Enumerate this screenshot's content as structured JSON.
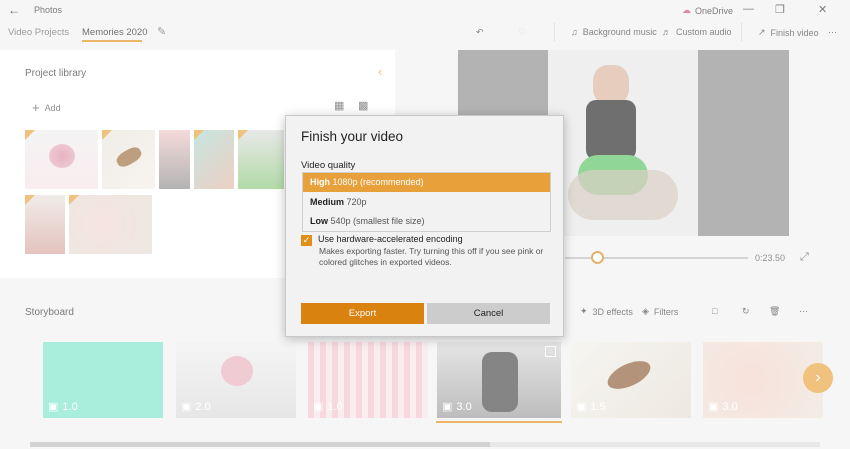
{
  "app": {
    "title": "Photos",
    "onedrive": "OneDrive"
  },
  "tabs": [
    {
      "label": "Video Projects"
    },
    {
      "label": "Memories 2020"
    }
  ],
  "toolbar": {
    "background_music": "Background music",
    "custom_audio": "Custom audio",
    "finish_video": "Finish video"
  },
  "library": {
    "title": "Project library",
    "add_label": "Add"
  },
  "player": {
    "time": "0:23.50"
  },
  "storyboard": {
    "title": "Storyboard",
    "tools": {
      "effects": "3D effects",
      "filters": "Filters"
    },
    "clips": [
      {
        "duration": "1.0"
      },
      {
        "duration": "2.0"
      },
      {
        "duration": "1.0"
      },
      {
        "duration": "3.0"
      },
      {
        "duration": "1.5"
      },
      {
        "duration": "3.0"
      }
    ]
  },
  "dialog": {
    "title": "Finish your video",
    "quality_label": "Video quality",
    "options": [
      {
        "name": "High",
        "detail": "1080p (recommended)",
        "selected": true
      },
      {
        "name": "Medium",
        "detail": "720p",
        "selected": false
      },
      {
        "name": "Low",
        "detail": "540p (smallest file size)",
        "selected": false
      }
    ],
    "hw_label": "Use hardware-accelerated encoding",
    "hw_desc": "Makes exporting faster. Try turning this off if you see pink or colored glitches in exported videos.",
    "export_label": "Export",
    "cancel_label": "Cancel"
  },
  "colors": {
    "accent": "#e8a13a",
    "accent_dark": "#d9820f"
  }
}
